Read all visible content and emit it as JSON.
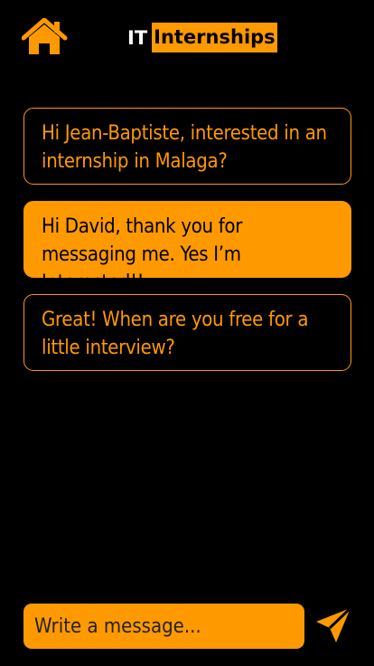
{
  "header": {
    "home_icon": "home-icon",
    "brand_prefix": "IT",
    "brand_name": "Internships",
    "accent_color": "#FF9900"
  },
  "messages": [
    {
      "direction": "received",
      "text": "Hi Jean-Baptiste, interested in an internship in Malaga?"
    },
    {
      "direction": "sent",
      "text": "Hi David, thank you for messaging me. Yes I’m Interested!!"
    },
    {
      "direction": "received",
      "text": "Great! When are you free for a little interview?"
    }
  ],
  "composer": {
    "placeholder": "Write a message...",
    "value": "",
    "send_icon": "send-icon"
  }
}
